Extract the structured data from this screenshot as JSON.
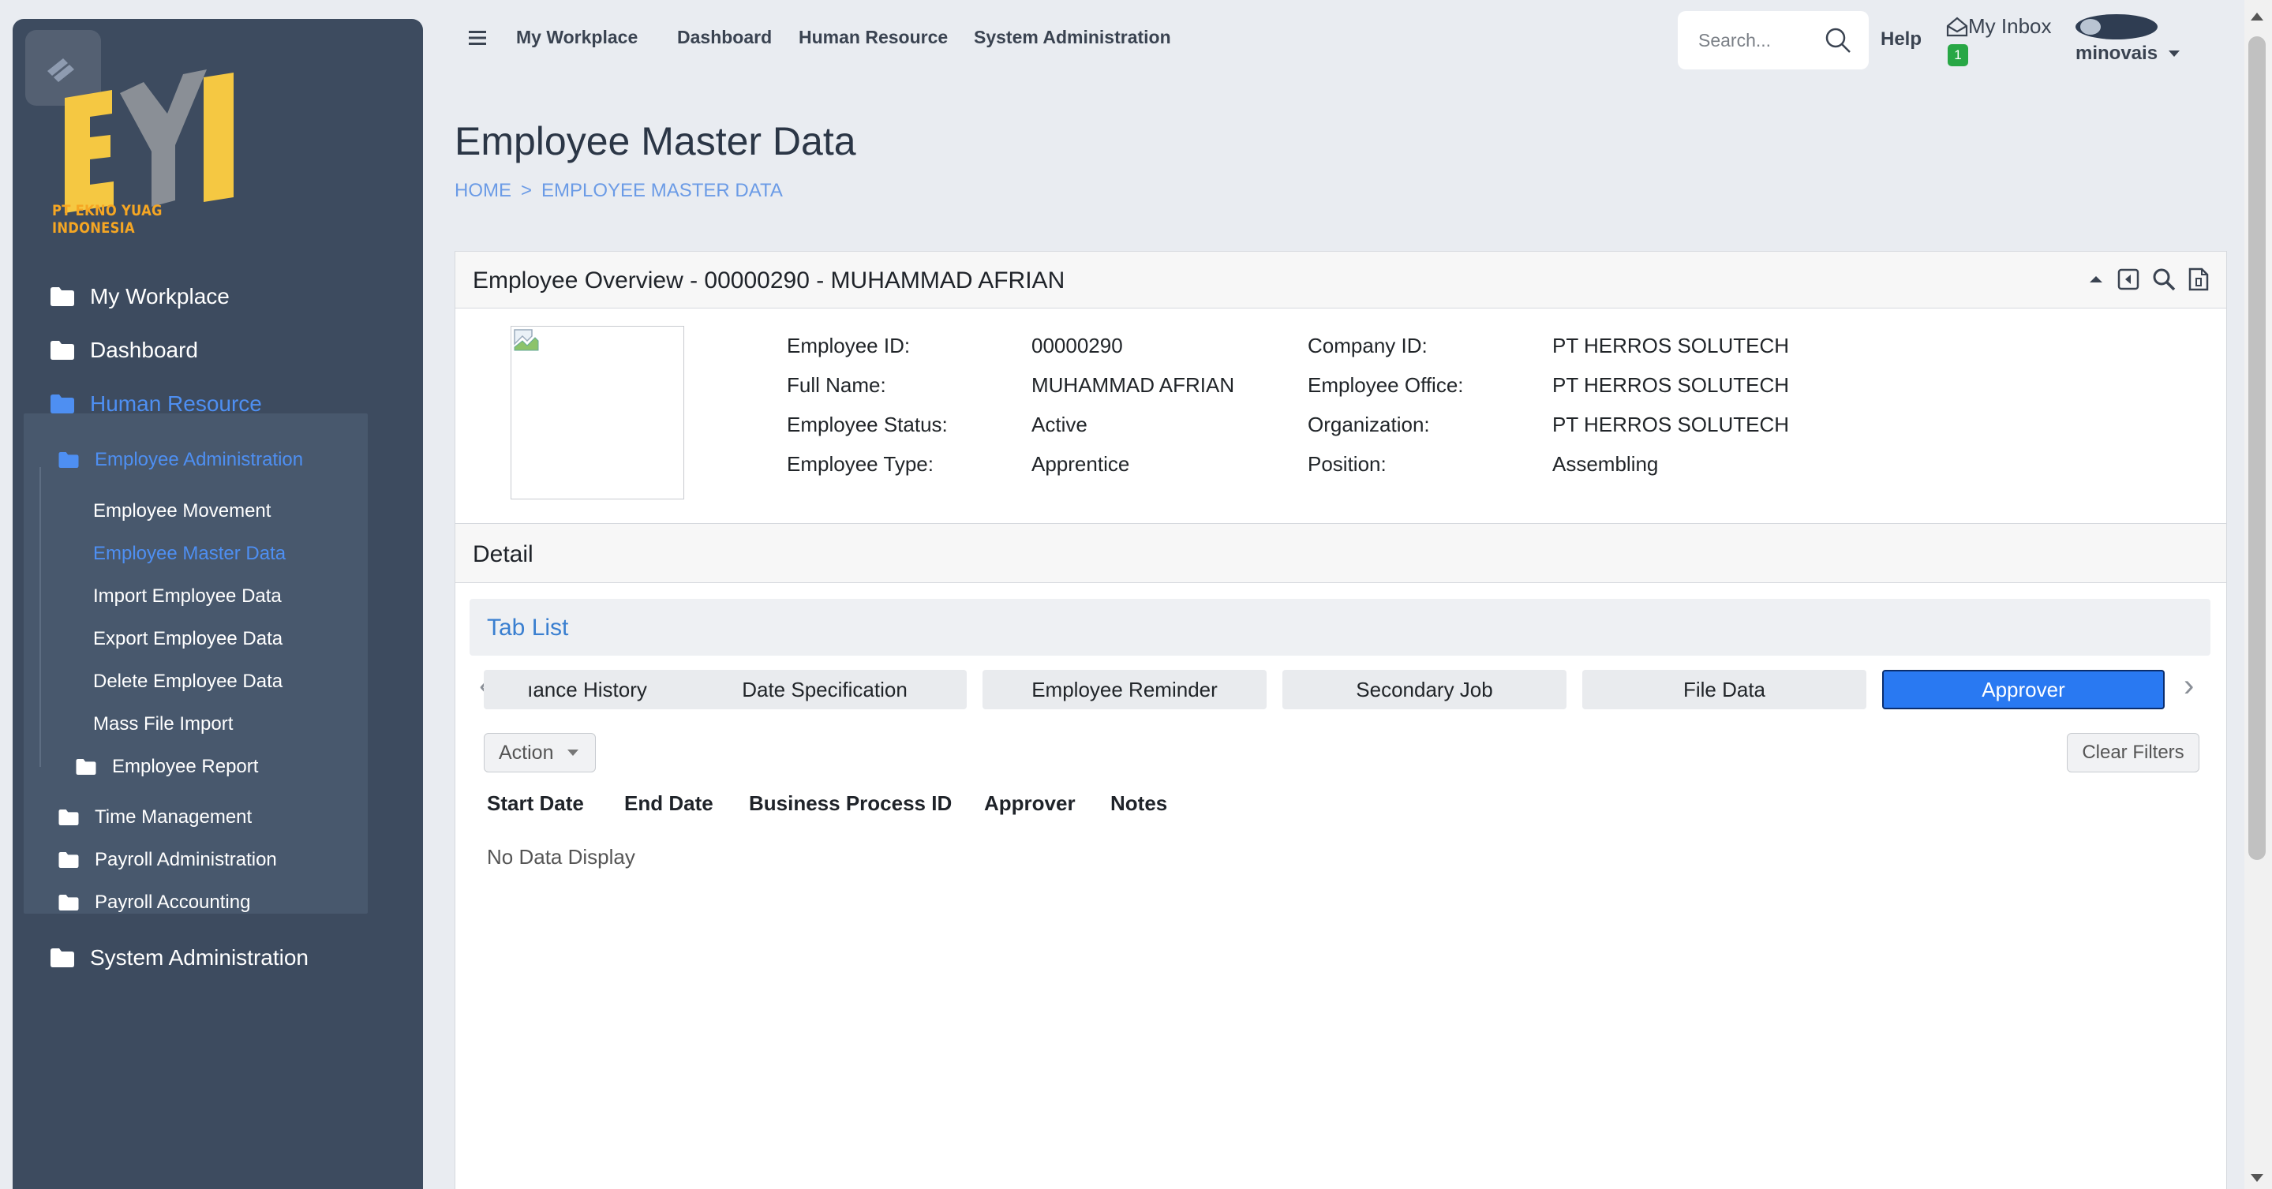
{
  "brand": {
    "logo_text": "PT EKNO YUAG INDONESIA",
    "logo_color": "#f5c842"
  },
  "sidebar": {
    "items": [
      {
        "label": "My Workplace"
      },
      {
        "label": "Dashboard"
      },
      {
        "label": "Human Resource"
      },
      {
        "label": "System Administration"
      }
    ],
    "human_resource": {
      "employee_administration": "Employee Administration",
      "sub_items": [
        {
          "label": "Employee Movement"
        },
        {
          "label": "Employee Master Data"
        },
        {
          "label": "Import Employee Data"
        },
        {
          "label": "Export Employee Data"
        },
        {
          "label": "Delete Employee Data"
        },
        {
          "label": "Mass File Import"
        }
      ],
      "employee_report": "Employee Report",
      "groups": [
        {
          "label": "Time Management"
        },
        {
          "label": "Payroll Administration"
        },
        {
          "label": "Payroll Accounting"
        }
      ]
    }
  },
  "topnav": {
    "links": [
      {
        "label": "My Workplace"
      },
      {
        "label": "Dashboard"
      },
      {
        "label": "Human Resource"
      },
      {
        "label": "System Administration"
      }
    ],
    "search_placeholder": "Search...",
    "help": "Help",
    "inbox": "My Inbox",
    "inbox_count": "1",
    "user": "minovais"
  },
  "page": {
    "title": "Employee Master Data",
    "breadcrumb": [
      "HOME",
      ">",
      "EMPLOYEE MASTER DATA"
    ]
  },
  "overview": {
    "title": "Employee Overview - 00000290 - MUHAMMAD AFRIAN",
    "fields_left": [
      {
        "label": "Employee ID:",
        "value": "00000290"
      },
      {
        "label": "Full Name:",
        "value": "MUHAMMAD AFRIAN"
      },
      {
        "label": "Employee Status:",
        "value": "Active"
      },
      {
        "label": "Employee Type:",
        "value": "Apprentice"
      }
    ],
    "fields_right": [
      {
        "label": "Company ID:",
        "value": "PT HERROS SOLUTECH"
      },
      {
        "label": "Employee Office:",
        "value": "PT HERROS SOLUTECH"
      },
      {
        "label": "Organization:",
        "value": "PT HERROS SOLUTECH"
      },
      {
        "label": "Position:",
        "value": "Assembling"
      }
    ]
  },
  "detail": {
    "title": "Detail",
    "tablist_title": "Tab List",
    "tabs": [
      {
        "label": "ıance History"
      },
      {
        "label": "Date Specification"
      },
      {
        "label": "Employee Reminder"
      },
      {
        "label": "Secondary Job"
      },
      {
        "label": "File Data"
      },
      {
        "label": "Approver"
      }
    ],
    "action_label": "Action",
    "clear_filters": "Clear Filters",
    "columns": [
      "Start Date",
      "End Date",
      "Business Process ID",
      "Approver",
      "Notes"
    ],
    "empty_text": "No Data Display"
  },
  "colors": {
    "sidebar_bg": "#3d4b5f",
    "accent": "#4e8ff2",
    "active_tab": "#2979f2"
  }
}
